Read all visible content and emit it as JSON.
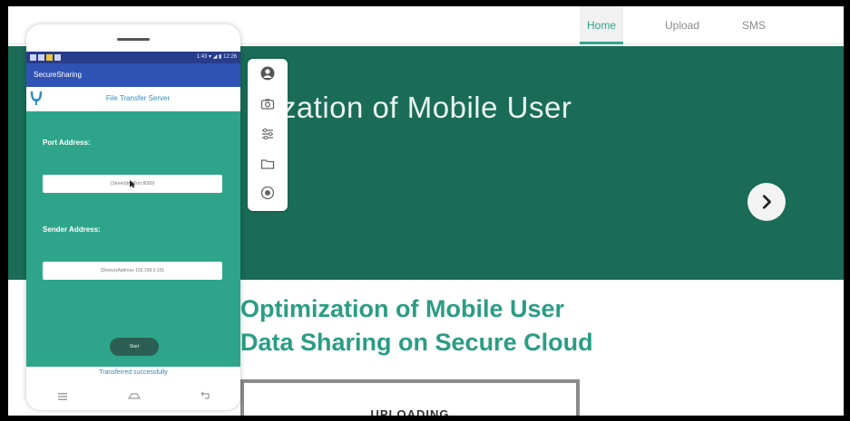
{
  "nav": {
    "items": [
      "Home",
      "Upload",
      "SMS"
    ],
    "active": "Home"
  },
  "hero": {
    "text": "ization of Mobile User"
  },
  "page": {
    "title_line1": "Optimization of Mobile User",
    "title_line2": "Data Sharing on Secure Cloud",
    "upload_label": "UPLOADING"
  },
  "phone": {
    "status_right": "1:43 ▾ ◢ ▮ 12:26",
    "app_title": "SecureSharing",
    "server_title": "File Transfer Server",
    "port_label": "Port Address:",
    "port_value": "(Street)dm(Port 8080)",
    "sender_label": "Sender Address:",
    "sender_value": "(Device)Address 192.168.0.101",
    "start_label": "Start",
    "result": "Transferred successfully"
  },
  "colors": {
    "hero": "#1a6c57",
    "accent": "#2ea58a",
    "app_bar": "#2f53b4"
  }
}
